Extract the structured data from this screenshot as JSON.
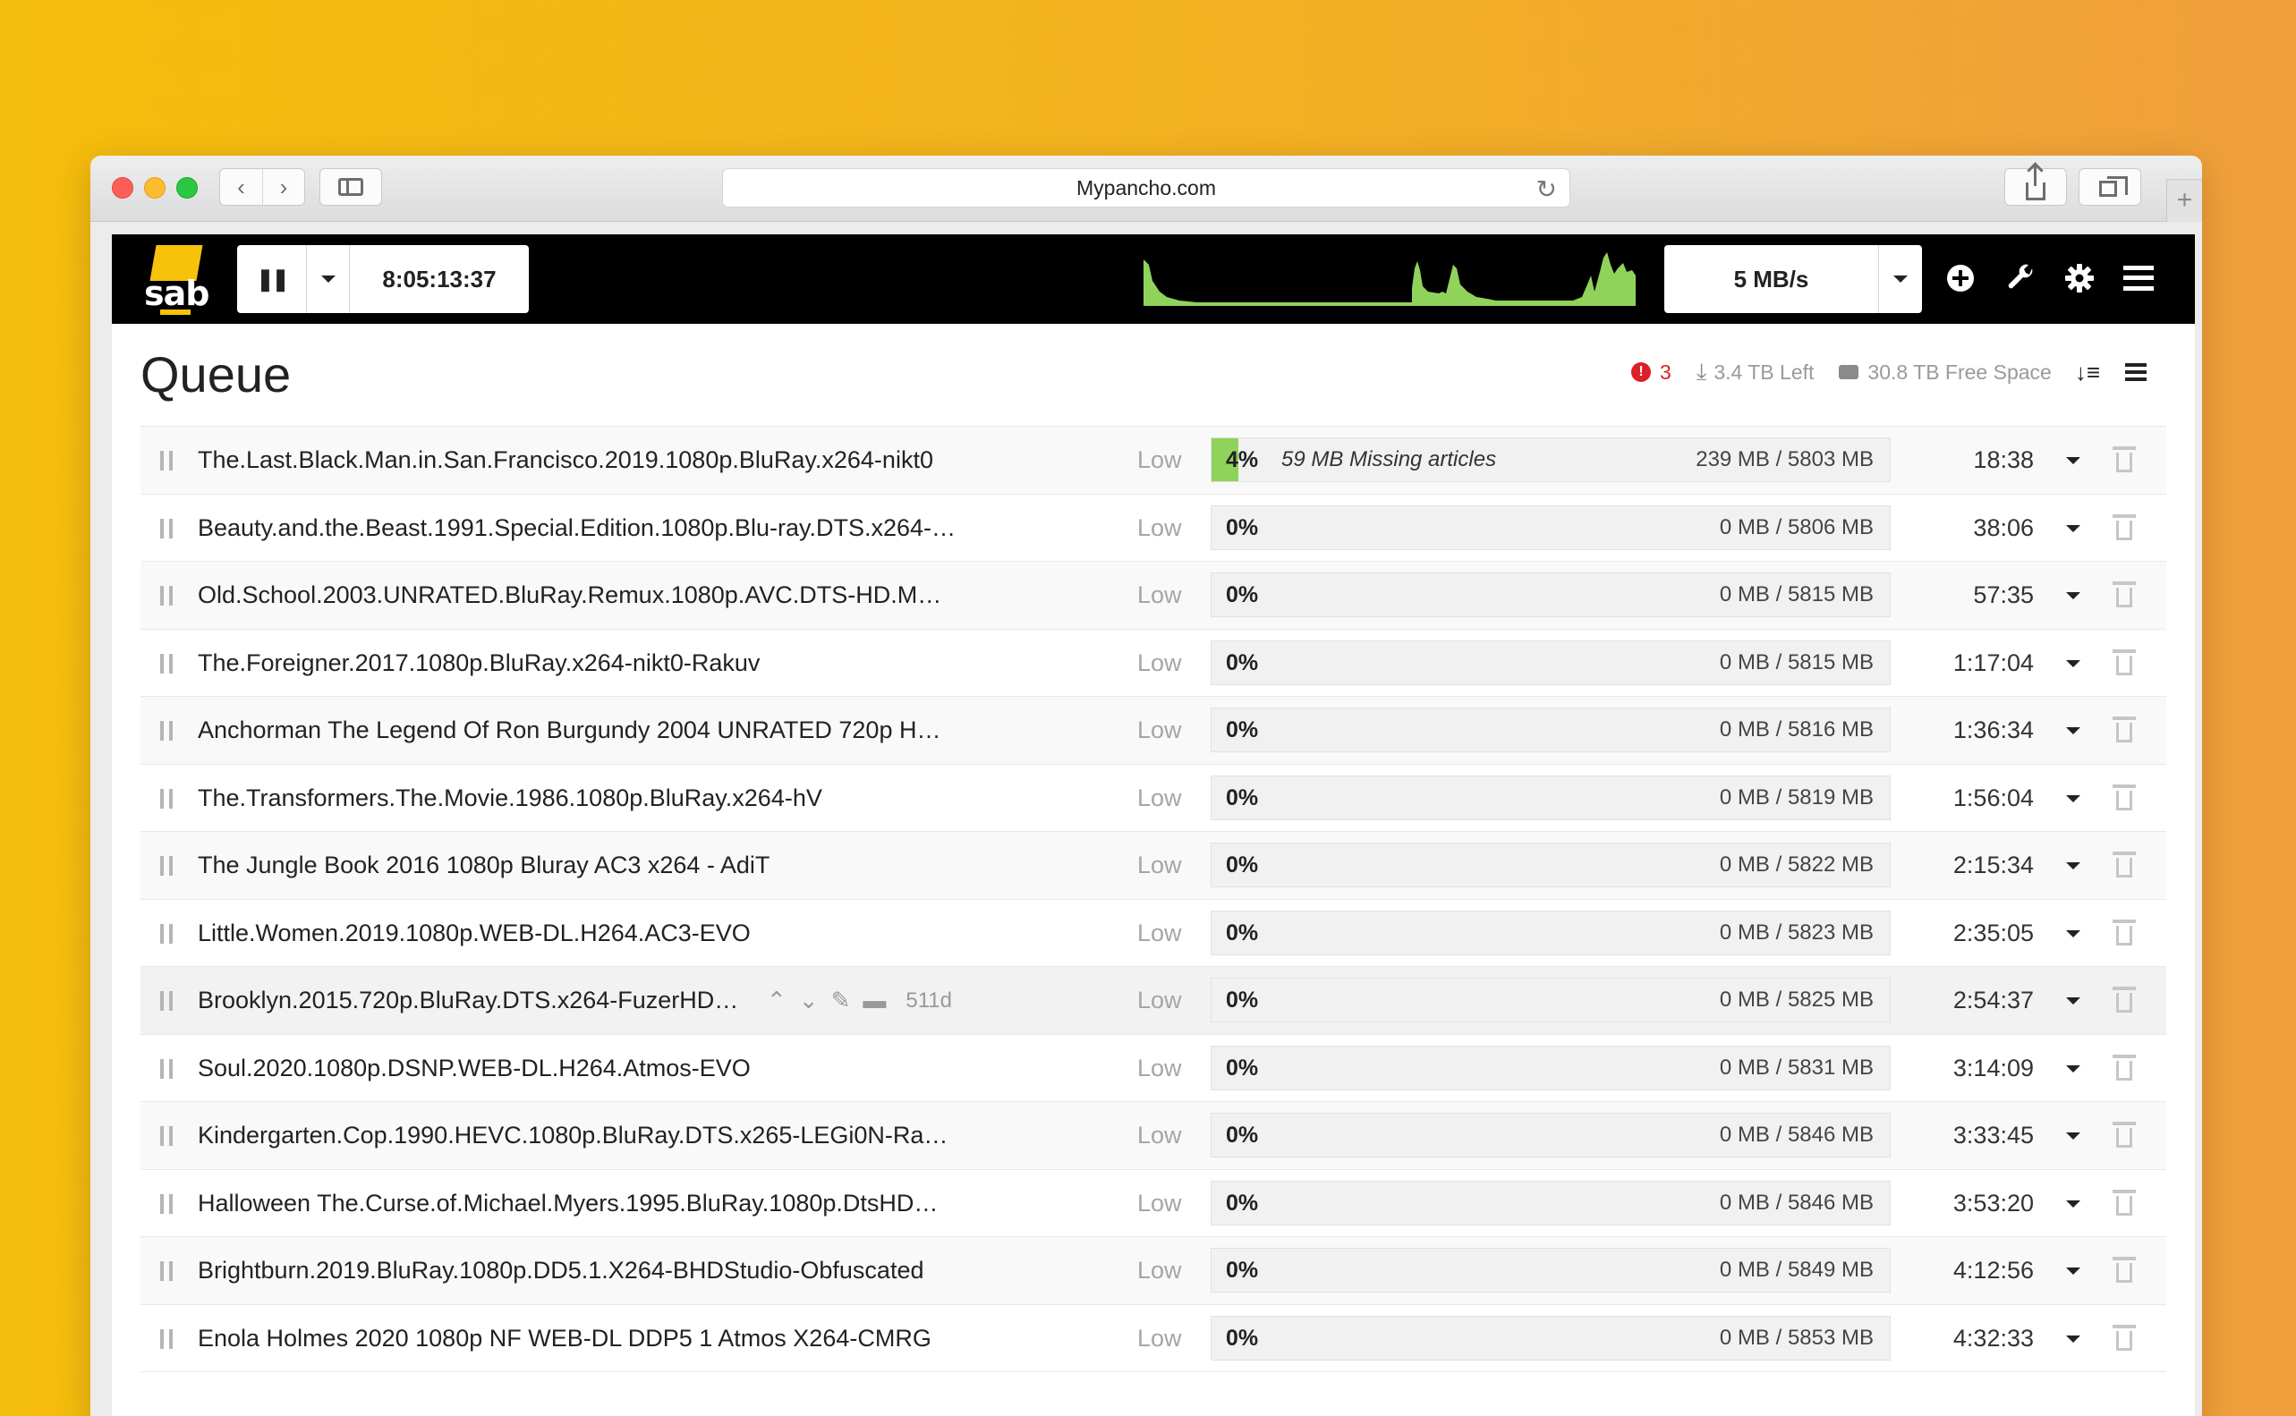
{
  "browser": {
    "url": "Mypancho.com",
    "nav_back": "‹",
    "nav_forward": "›",
    "reload_icon": "↻",
    "new_tab": "+"
  },
  "header": {
    "logo_text": "sab",
    "pause_icon": "❚❚",
    "timer": "8:05:13:37",
    "speed_limit": "5 MB/s",
    "speed_graph_color": "#8fd35a"
  },
  "queue": {
    "title": "Queue",
    "warnings_count": "3",
    "remaining": "3.4 TB Left",
    "free_space": "30.8 TB Free Space",
    "sort_icon": "↓≡"
  },
  "hover_row": {
    "up_icon": "⌃",
    "down_icon": "⌄",
    "edit_icon": "✎",
    "folder_icon": "▬",
    "age": "511d"
  },
  "rows": [
    {
      "name": "The.Last.Black.Man.in.San.Francisco.2019.1080p.BluRay.x264-nikt0",
      "priority": "Low",
      "percent": "4%",
      "progress": 0.04,
      "note": "59 MB Missing articles",
      "size": "239 MB / 5803 MB",
      "eta": "18:38"
    },
    {
      "name": "Beauty.and.the.Beast.1991.Special.Edition.1080p.Blu-ray.DTS.x264-…",
      "priority": "Low",
      "percent": "0%",
      "progress": 0,
      "note": "",
      "size": "0 MB / 5806 MB",
      "eta": "38:06"
    },
    {
      "name": "Old.School.2003.UNRATED.BluRay.Remux.1080p.AVC.DTS-HD.M…",
      "priority": "Low",
      "percent": "0%",
      "progress": 0,
      "note": "",
      "size": "0 MB / 5815 MB",
      "eta": "57:35"
    },
    {
      "name": "The.Foreigner.2017.1080p.BluRay.x264-nikt0-Rakuv",
      "priority": "Low",
      "percent": "0%",
      "progress": 0,
      "note": "",
      "size": "0 MB / 5815 MB",
      "eta": "1:17:04"
    },
    {
      "name": "Anchorman The Legend Of Ron Burgundy 2004 UNRATED 720p H…",
      "priority": "Low",
      "percent": "0%",
      "progress": 0,
      "note": "",
      "size": "0 MB / 5816 MB",
      "eta": "1:36:34"
    },
    {
      "name": "The.Transformers.The.Movie.1986.1080p.BluRay.x264-hV",
      "priority": "Low",
      "percent": "0%",
      "progress": 0,
      "note": "",
      "size": "0 MB / 5819 MB",
      "eta": "1:56:04"
    },
    {
      "name": "The Jungle Book 2016 1080p Bluray AC3 x264 - AdiT",
      "priority": "Low",
      "percent": "0%",
      "progress": 0,
      "note": "",
      "size": "0 MB / 5822 MB",
      "eta": "2:15:34"
    },
    {
      "name": "Little.Women.2019.1080p.WEB-DL.H264.AC3-EVO",
      "priority": "Low",
      "percent": "0%",
      "progress": 0,
      "note": "",
      "size": "0 MB / 5823 MB",
      "eta": "2:35:05"
    },
    {
      "name": "Brooklyn.2015.720p.BluRay.DTS.x264-FuzerHD…",
      "priority": "Low",
      "percent": "0%",
      "progress": 0,
      "note": "",
      "size": "0 MB / 5825 MB",
      "eta": "2:54:37"
    },
    {
      "name": "Soul.2020.1080p.DSNP.WEB-DL.H264.Atmos-EVO",
      "priority": "Low",
      "percent": "0%",
      "progress": 0,
      "note": "",
      "size": "0 MB / 5831 MB",
      "eta": "3:14:09"
    },
    {
      "name": "Kindergarten.Cop.1990.HEVC.1080p.BluRay.DTS.x265-LEGi0N-Ra…",
      "priority": "Low",
      "percent": "0%",
      "progress": 0,
      "note": "",
      "size": "0 MB / 5846 MB",
      "eta": "3:33:45"
    },
    {
      "name": "Halloween The.Curse.of.Michael.Myers.1995.BluRay.1080p.DtsHD…",
      "priority": "Low",
      "percent": "0%",
      "progress": 0,
      "note": "",
      "size": "0 MB / 5846 MB",
      "eta": "3:53:20"
    },
    {
      "name": "Brightburn.2019.BluRay.1080p.DD5.1.X264-BHDStudio-Obfuscated",
      "priority": "Low",
      "percent": "0%",
      "progress": 0,
      "note": "",
      "size": "0 MB / 5849 MB",
      "eta": "4:12:56"
    },
    {
      "name": "Enola Holmes 2020 1080p NF WEB-DL DDP5 1 Atmos X264-CMRG",
      "priority": "Low",
      "percent": "0%",
      "progress": 0,
      "note": "",
      "size": "0 MB / 5853 MB",
      "eta": "4:32:33"
    }
  ]
}
